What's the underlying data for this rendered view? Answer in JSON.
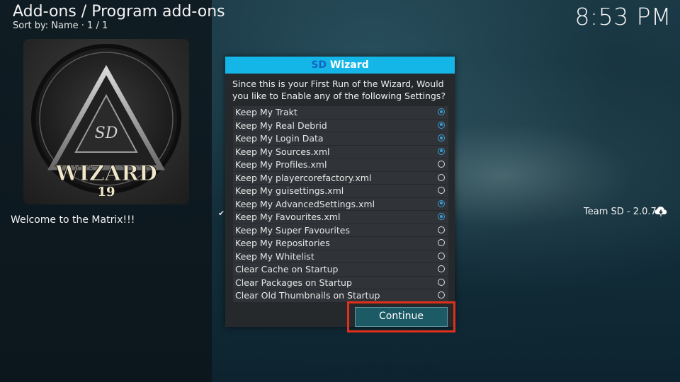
{
  "header": {
    "title": "Add-ons / Program add-ons",
    "sort": "Sort by: Name  ·  1 / 1",
    "clock": "8:53 PM"
  },
  "addon": {
    "logo_text_main": "WIZARD",
    "logo_text_num": "19",
    "logo_text_sd": "SD",
    "description": "Welcome to the Matrix!!!",
    "author_version": "Team SD - 2.0.7"
  },
  "dialog": {
    "title_sd": "SD",
    "title_rest": " Wizard",
    "message": "Since this is your First Run of the Wizard, Would you like to Enable any of the following Settings?",
    "options": [
      {
        "label": "Keep My Trakt",
        "checked": true
      },
      {
        "label": "Keep My Real Debrid",
        "checked": true
      },
      {
        "label": "Keep My Login Data",
        "checked": true
      },
      {
        "label": "Keep My Sources.xml",
        "checked": true
      },
      {
        "label": "Keep My Profiles.xml",
        "checked": false
      },
      {
        "label": "Keep My playercorefactory.xml",
        "checked": false
      },
      {
        "label": "Keep My guisettings.xml",
        "checked": false
      },
      {
        "label": "Keep My AdvancedSettings.xml",
        "checked": true
      },
      {
        "label": "Keep My Favourites.xml",
        "checked": true
      },
      {
        "label": "Keep My Super Favourites",
        "checked": false
      },
      {
        "label": "Keep My Repositories",
        "checked": false
      },
      {
        "label": "Keep My Whitelist",
        "checked": false
      },
      {
        "label": "Clear Cache on Startup",
        "checked": false
      },
      {
        "label": "Clear Packages on Startup",
        "checked": false
      },
      {
        "label": "Clear Old Thumbnails on Startup",
        "checked": false
      }
    ],
    "continue_label": "Continue"
  },
  "icons": {
    "cloud": "cloud-download-icon",
    "check": "checkmark-icon",
    "radio": "radio-icon"
  },
  "colors": {
    "title_bar": "#14b6e8",
    "sd_text": "#1565c0",
    "radio_on": "#3aa0d8",
    "highlight_border": "#e0301b",
    "button_bg": "#1c5a66"
  }
}
